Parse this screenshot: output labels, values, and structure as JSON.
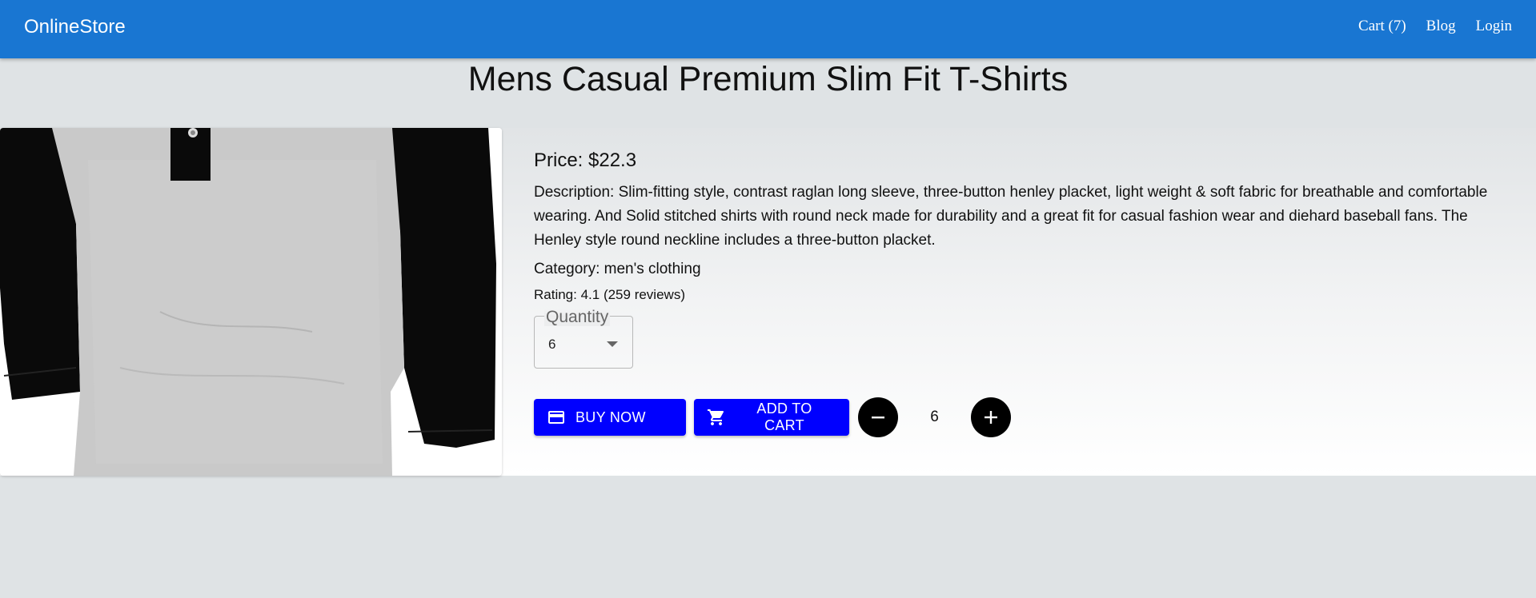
{
  "header": {
    "brand": "OnlineStore",
    "nav": {
      "cart": "Cart (7)",
      "blog": "Blog",
      "login": "Login"
    }
  },
  "product": {
    "title": "Mens Casual Premium Slim Fit T-Shirts",
    "price": "Price: $22.3",
    "description": "Description: Slim-fitting style, contrast raglan long sleeve, three-button henley placket, light weight & soft fabric for breathable and comfortable wearing. And Solid stitched shirts with round neck made for durability and a great fit for casual fashion wear and diehard baseball fans. The Henley style round neckline includes a three-button placket.",
    "category": "Category: men's clothing",
    "rating": "Rating: 4.1 (259 reviews)"
  },
  "quantity_select": {
    "label": "Quantity",
    "value": "6"
  },
  "actions": {
    "buy_now": "BUY NOW",
    "add_to_cart": "ADD TO CART",
    "count": "6"
  },
  "icons": {
    "buy": "credit-card-icon",
    "cart": "shopping-cart-icon",
    "decrease": "minus-icon",
    "increase": "plus-icon",
    "select": "caret-down-icon"
  },
  "colors": {
    "appbar": "#1976d2",
    "button": "#0000ff",
    "round_button": "#000000",
    "background": "#dfe3e5"
  }
}
